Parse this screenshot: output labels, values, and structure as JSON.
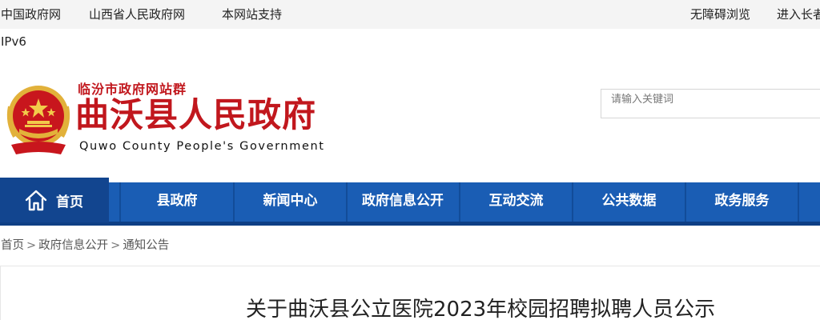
{
  "topbar": {
    "links": [
      "中国政府网",
      "山西省人民政府网",
      "本网站支持"
    ],
    "accessible_label": "无障碍浏览",
    "elder_label": "进入长者"
  },
  "ipv6_label": "IPv6",
  "header": {
    "site_group": "临汾市政府网站群",
    "title": "曲沃县人民政府",
    "title_en": "Quwo County People's Government"
  },
  "search": {
    "placeholder": "请输入关键词"
  },
  "nav": {
    "home": "首页",
    "items": [
      "县政府",
      "新闻中心",
      "政府信息公开",
      "互动交流",
      "公共数据",
      "政务服务"
    ]
  },
  "breadcrumb": [
    "首页",
    "政府信息公开",
    "通知公告"
  ],
  "article": {
    "title": "关于曲沃县公立医院2023年校园招聘拟聘人员公示"
  },
  "colors": {
    "brand_red": "#c1171d",
    "nav_blue": "#1a5db4",
    "nav_home_blue": "#12458f"
  },
  "icons": {
    "emblem": "national-emblem-icon",
    "home": "home-icon"
  }
}
